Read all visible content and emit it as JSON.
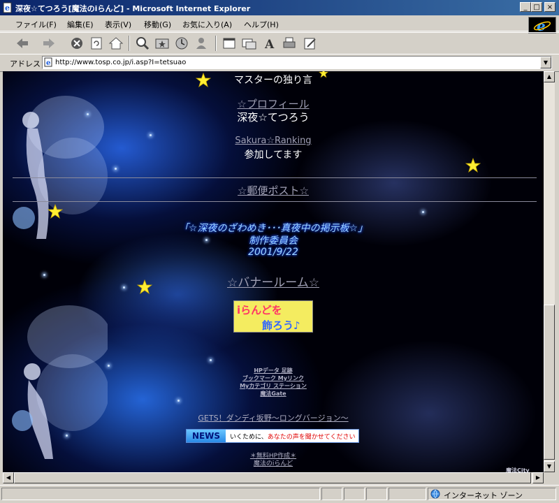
{
  "window": {
    "title": "深夜☆てつろう[魔法のiらんど] - Microsoft Internet Explorer",
    "minimize": "_",
    "maximize": "□",
    "close": "×"
  },
  "menu": {
    "items": [
      "ファイル(F)",
      "編集(E)",
      "表示(V)",
      "移動(G)",
      "お気に入り(A)",
      "ヘルプ(H)"
    ]
  },
  "address": {
    "label": "アドレス",
    "url": "http://www.tosp.co.jp/i.asp?I=tetsuao"
  },
  "page": {
    "master_line": "マスターの独り言",
    "profile_link": "☆プロフィール",
    "profile_name": "深夜☆てつろう",
    "ranking_link": "Sakura☆Ranking",
    "ranking_text": "参加してます",
    "post_link": "☆郵便ポスト☆",
    "credit_line1": "「☆深夜のざわめき･･･真夜中の掲示板☆」",
    "credit_line2": "制作委員会",
    "credit_line3": "2001/9/22",
    "banner_room": "☆バナールーム☆",
    "banner_text1": "iらんどを",
    "banner_text2": "飾ろう♪",
    "footer_links": [
      "HPデータ 足跡",
      "ブックマーク Myリンク",
      "Myカテゴリ ステーション",
      "魔法Gate"
    ],
    "gets_link": "GETS！ダンディ坂野～ロングバージョン～",
    "news_label": "NEWS",
    "news_text_a": "いくために、",
    "news_text_b": "あなたの声を聞かせてください",
    "free_hp": "＊無料HP作成＊",
    "mahou_iland": "魔法のiらんど",
    "mahou_city": "魔法City"
  },
  "status": {
    "zone": "インターネット ゾーン"
  },
  "colors": {
    "titlebar_start": "#0a246a",
    "titlebar_end": "#3a6ea5",
    "chrome": "#d4d0c8",
    "star": "#ffee33",
    "link_gray": "#a0a0b4",
    "glow_text": "#9cd4ff",
    "news_red": "#e00000"
  },
  "icons": [
    "ie-page-icon",
    "back-icon",
    "forward-icon",
    "stop-icon",
    "refresh-icon",
    "home-icon",
    "search-icon",
    "favorites-icon",
    "history-icon",
    "messenger-icon",
    "fullscreen-icon",
    "mail-icon",
    "font-icon",
    "print-icon",
    "edit-icon",
    "ie-logo-icon",
    "star-icon",
    "globe-icon"
  ]
}
